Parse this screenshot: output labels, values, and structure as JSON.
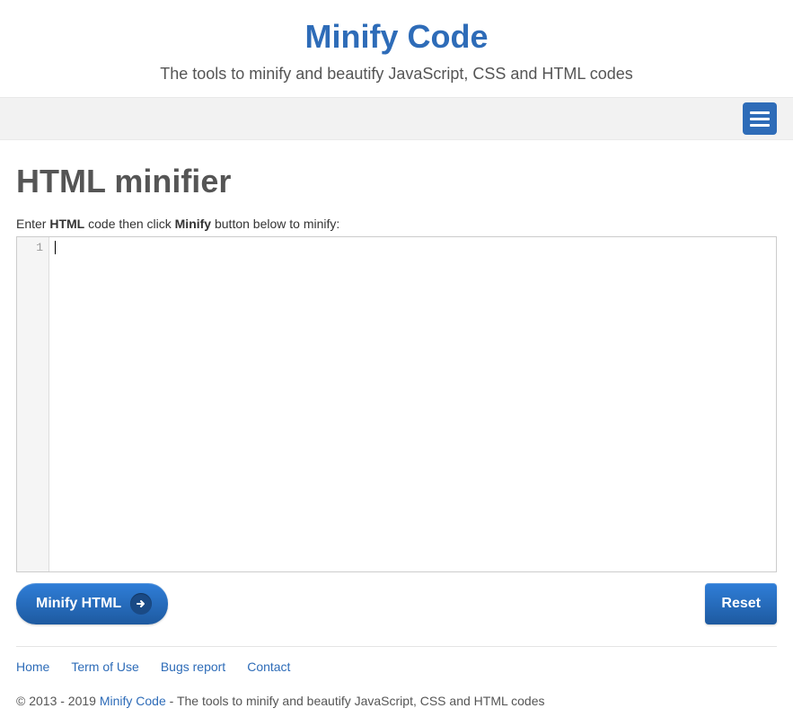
{
  "header": {
    "title": "Minify Code",
    "subtitle": "The tools to minify and beautify JavaScript, CSS and HTML codes"
  },
  "page": {
    "title": "HTML minifier",
    "instruction_prefix": "Enter ",
    "instruction_bold1": "HTML",
    "instruction_mid": " code then click ",
    "instruction_bold2": "Minify",
    "instruction_suffix": " button below to minify:"
  },
  "editor": {
    "line_number": "1",
    "content": ""
  },
  "buttons": {
    "minify": "Minify HTML",
    "reset": "Reset"
  },
  "footer": {
    "links": [
      "Home",
      "Term of Use",
      "Bugs report",
      "Contact"
    ],
    "copyright_prefix": "© 2013 - 2019 ",
    "copyright_link": "Minify Code",
    "copyright_suffix": " - The tools to minify and beautify JavaScript, CSS and HTML codes"
  }
}
